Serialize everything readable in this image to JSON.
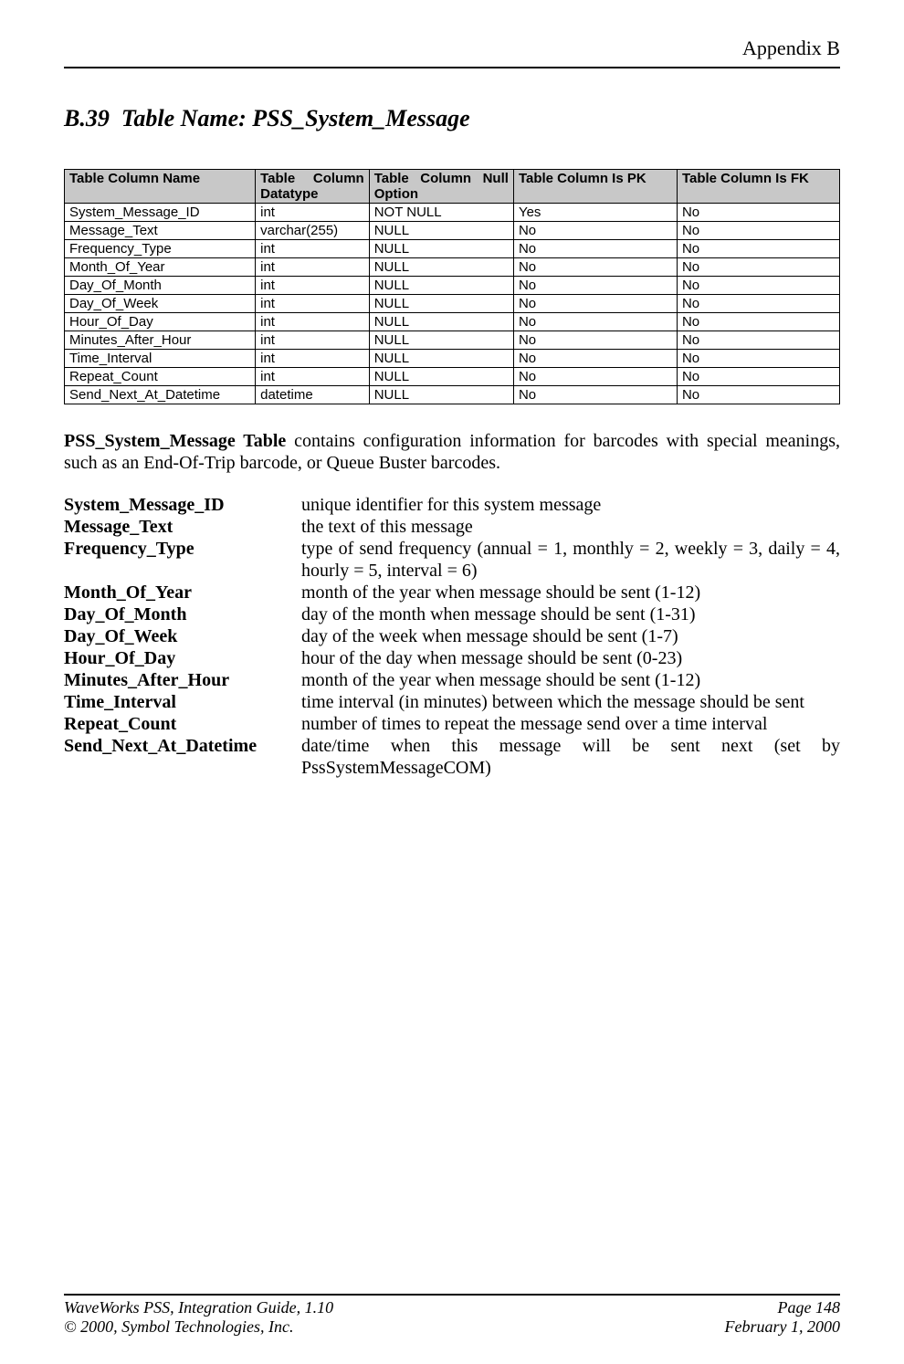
{
  "header": {
    "right": "Appendix B"
  },
  "section": {
    "number": "B.39",
    "label": "Table Name: PSS_System_Message"
  },
  "table": {
    "headers": {
      "c0": "Table Column Name",
      "c1a": "Table",
      "c1b": "Column",
      "c1_line2": "Datatype",
      "c2a": "Table",
      "c2b": "Column",
      "c2c": "Null",
      "c2_line2": "Option",
      "c3": "Table Column Is PK",
      "c4": "Table Column Is FK"
    },
    "rows": [
      {
        "name": "System_Message_ID",
        "dtype": "int",
        "nullopt": "NOT NULL",
        "pk": "Yes",
        "fk": "No"
      },
      {
        "name": "Message_Text",
        "dtype": "varchar(255)",
        "nullopt": "NULL",
        "pk": "No",
        "fk": "No"
      },
      {
        "name": "Frequency_Type",
        "dtype": "int",
        "nullopt": "NULL",
        "pk": "No",
        "fk": "No"
      },
      {
        "name": "Month_Of_Year",
        "dtype": "int",
        "nullopt": "NULL",
        "pk": "No",
        "fk": "No"
      },
      {
        "name": "Day_Of_Month",
        "dtype": "int",
        "nullopt": "NULL",
        "pk": "No",
        "fk": "No"
      },
      {
        "name": "Day_Of_Week",
        "dtype": "int",
        "nullopt": "NULL",
        "pk": "No",
        "fk": "No"
      },
      {
        "name": "Hour_Of_Day",
        "dtype": "int",
        "nullopt": "NULL",
        "pk": "No",
        "fk": "No"
      },
      {
        "name": "Minutes_After_Hour",
        "dtype": "int",
        "nullopt": "NULL",
        "pk": "No",
        "fk": "No"
      },
      {
        "name": "Time_Interval",
        "dtype": "int",
        "nullopt": "NULL",
        "pk": "No",
        "fk": "No"
      },
      {
        "name": "Repeat_Count",
        "dtype": "int",
        "nullopt": "NULL",
        "pk": "No",
        "fk": "No"
      },
      {
        "name": "Send_Next_At_Datetime",
        "dtype": "datetime",
        "nullopt": "NULL",
        "pk": "No",
        "fk": "No"
      }
    ]
  },
  "intro": {
    "bold": "PSS_System_Message Table",
    "rest": " contains configuration information for barcodes with special meanings, such as an End-Of-Trip barcode, or Queue Buster barcodes."
  },
  "defs": [
    {
      "term": "System_Message_ID",
      "desc": "unique identifier for this system message"
    },
    {
      "term": "Message_Text",
      "desc": "the text of this message"
    },
    {
      "term": "Frequency_Type",
      "desc": "type of send frequency (annual = 1, monthly = 2, weekly = 3, daily = 4, hourly = 5, interval = 6)"
    },
    {
      "term": "Month_Of_Year",
      "desc": "month of the year when message should be sent (1-12)"
    },
    {
      "term": "Day_Of_Month",
      "desc": "day of the month when message should be sent (1-31)"
    },
    {
      "term": "Day_Of_Week",
      "desc": "day of the week when message should be sent (1-7)"
    },
    {
      "term": "Hour_Of_Day",
      "desc": "hour of the day when message should be sent (0-23)"
    },
    {
      "term": "Minutes_After_Hour",
      "desc": "month of the year when message should be sent (1-12)"
    },
    {
      "term": "Time_Interval",
      "desc": "time interval (in minutes) between which the message should be sent"
    },
    {
      "term": "Repeat_Count",
      "desc": "number of times to repeat the message send over a time interval"
    },
    {
      "term": "Send_Next_At_Datetime",
      "desc": "date/time when this message will be sent next (set by PssSystemMessageCOM)"
    }
  ],
  "footer": {
    "left1": "WaveWorks PSS, Integration Guide, 1.10",
    "right1": "Page 148",
    "left2": "© 2000, Symbol Technologies, Inc.",
    "right2": "February 1, 2000"
  }
}
